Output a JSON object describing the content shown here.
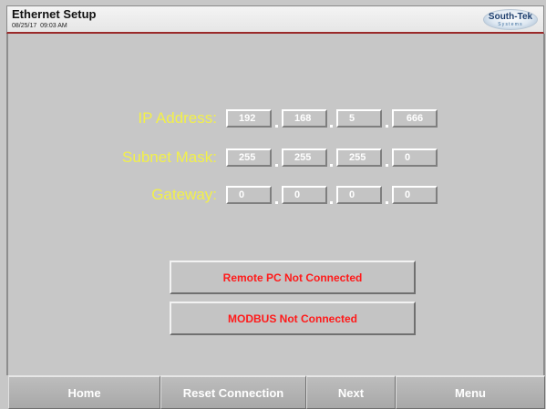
{
  "header": {
    "title": "Ethernet Setup",
    "datetime": "08/25/17  09:03 AM",
    "logo_name": "South-Tek",
    "logo_sub": "Systems"
  },
  "ip_address": {
    "label": "IP Address:",
    "octets": [
      "192",
      "168",
      "5",
      "666"
    ]
  },
  "subnet_mask": {
    "label": "Subnet Mask:",
    "octets": [
      "255",
      "255",
      "255",
      "0"
    ]
  },
  "gateway": {
    "label": "Gateway:",
    "octets": [
      "0",
      "0",
      "0",
      "0"
    ]
  },
  "status": {
    "remote_pc": "Remote PC Not Connected",
    "modbus": "MODBUS Not Connected"
  },
  "nav": {
    "home": "Home",
    "reset": "Reset Connection",
    "next": "Next",
    "menu": "Menu"
  },
  "colors": {
    "label_yellow": "#f2f04a",
    "status_red": "#ff1a1a",
    "background": "#c7c7c7"
  }
}
